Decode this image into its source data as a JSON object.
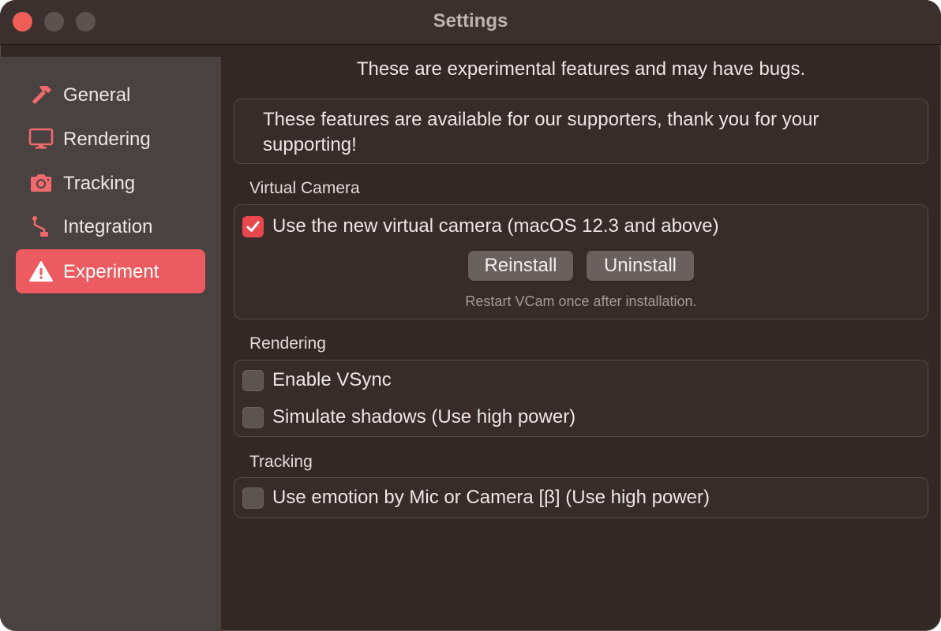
{
  "window": {
    "title": "Settings"
  },
  "sidebar": {
    "items": [
      {
        "label": "General",
        "icon": "hammer-icon",
        "active": false
      },
      {
        "label": "Rendering",
        "icon": "monitor-icon",
        "active": false
      },
      {
        "label": "Tracking",
        "icon": "camera-icon",
        "active": false
      },
      {
        "label": "Integration",
        "icon": "integration-icon",
        "active": false
      },
      {
        "label": "Experiment",
        "icon": "warning-icon",
        "active": true
      }
    ]
  },
  "experiment": {
    "heading": "These are experimental features and may have bugs.",
    "supporter_notice": "These features are available for our supporters, thank you for your supporting!",
    "virtual_camera": {
      "section_label": "Virtual Camera",
      "new_camera_label": "Use the new virtual camera (macOS 12.3 and above)",
      "new_camera_checked": true,
      "reinstall_label": "Reinstall",
      "uninstall_label": "Uninstall",
      "hint": "Restart VCam once after installation."
    },
    "rendering": {
      "section_label": "Rendering",
      "vsync_label": "Enable VSync",
      "vsync_checked": false,
      "shadows_label": "Simulate shadows (Use high power)",
      "shadows_checked": false
    },
    "tracking": {
      "section_label": "Tracking",
      "emotion_label": "Use emotion by Mic or Camera [β] (Use high power)",
      "emotion_checked": false
    }
  },
  "colors": {
    "accent": "#ec5b5f",
    "checkbox_checked": "#e8484c",
    "window_bg": "#342826",
    "sidebar_bg": "#4a4241"
  }
}
